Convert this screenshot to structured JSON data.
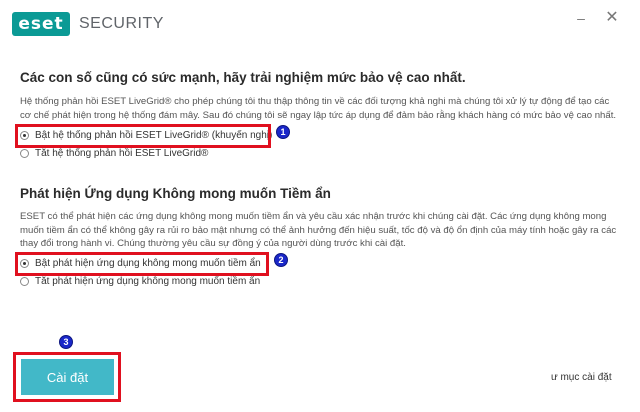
{
  "header": {
    "logo_badge": "eset",
    "product_name": "SECURITY"
  },
  "window_controls": {
    "minimize": "–",
    "close": "✕"
  },
  "livegrid": {
    "title": "Các con số cũng có sức mạnh, hãy trải nghiệm mức bảo vệ cao nhất.",
    "description": "Hệ thống phản hồi ESET LiveGrid® cho phép chúng tôi thu thập thông tin về các đối tượng khả nghi mà chúng tôi xử lý tự động để tạo các cơ chế phát hiện trong hệ thống đám mây. Sau đó chúng tôi sẽ ngay lập tức áp dụng để đảm bảo rằng khách hàng có mức bảo vệ cao nhất.",
    "option_enable": "Bật hệ thống phản hồi ESET LiveGrid® (khuyến nghị)",
    "option_disable": "Tắt hệ thống phản hồi ESET LiveGrid®",
    "selected": "enable"
  },
  "pua": {
    "title": "Phát hiện Ứng dụng Không mong muốn Tiềm ẩn",
    "description": "ESET có thể phát hiện các ứng dụng không mong muốn tiềm ẩn và yêu cầu xác nhận trước khi chúng cài đặt. Các ứng dụng không mong muốn tiềm ẩn có thể không gây ra rủi ro bảo mật nhưng có thể ảnh hưởng đến hiệu suất, tốc độ và độ ổn định của máy tính hoặc gây ra các thay đổi trong hành vi. Chúng thường yêu cầu sự đồng ý của người dùng trước khi cài đặt.",
    "option_enable": "Bật phát hiện ứng dụng không mong muốn tiềm ẩn",
    "option_disable": "Tắt phát hiện ứng dụng không mong muốn tiềm ẩn",
    "selected": "enable"
  },
  "markers": {
    "one": "1",
    "two": "2",
    "three": "3"
  },
  "footer": {
    "install_label": "Cài đặt",
    "folder_link": "ư mục cài đặt"
  },
  "colors": {
    "brand": "#0b9a95",
    "button": "#42b8c8",
    "highlight": "#e0101f",
    "marker": "#1a27c9"
  }
}
